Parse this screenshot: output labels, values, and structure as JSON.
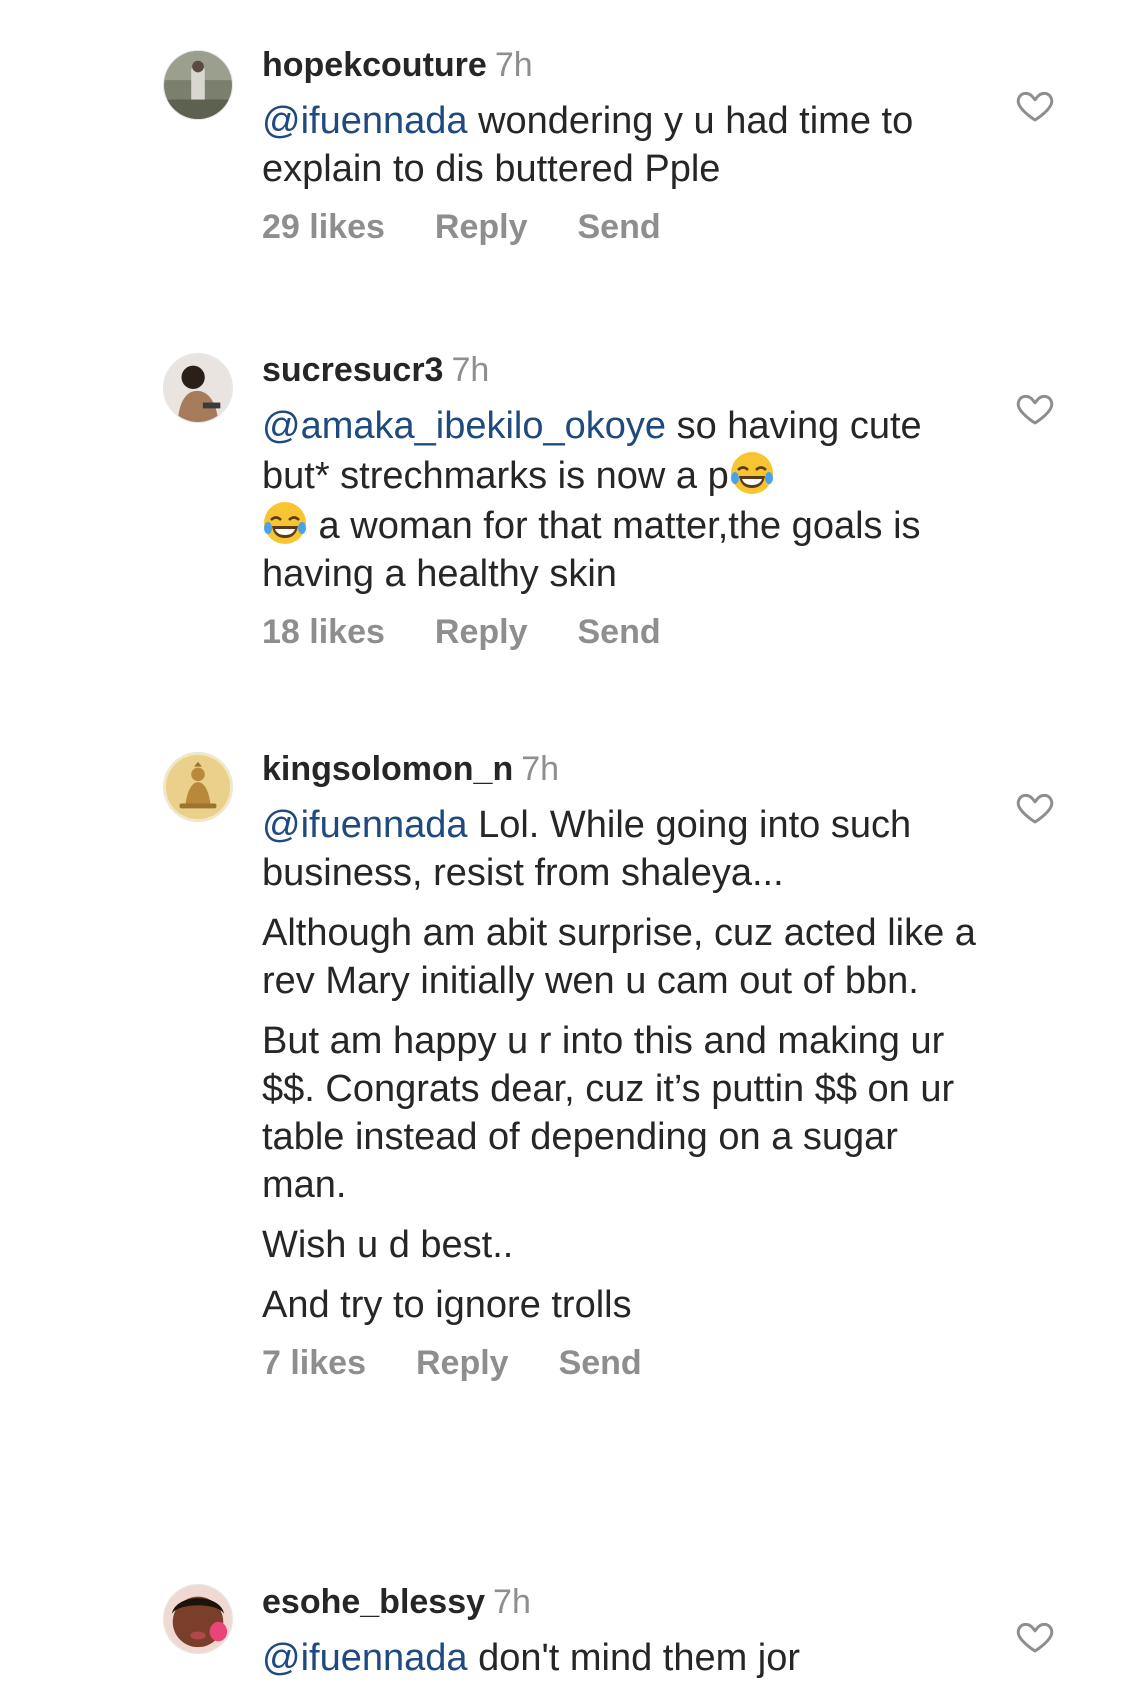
{
  "comments": [
    {
      "username": "hopekcouture",
      "time": "7h",
      "mention": "@ifuennada",
      "text_after_mention": " wondering y u had time to explain to dis buttered Pple",
      "likes": "29 likes",
      "reply": "Reply",
      "send": "Send"
    },
    {
      "username": "sucresucr3",
      "time": "7h",
      "mention": "@amaka_ibekilo_okoye",
      "text_part1": " so having cute but* strechmarks is now a p",
      "text_part2": " a woman for that matter,the goals is having a healthy skin",
      "emoji": "face-with-tears-of-joy",
      "likes": "18 likes",
      "reply": "Reply",
      "send": "Send"
    },
    {
      "username": "kingsolomon_n",
      "time": "7h",
      "mention": "@ifuennada",
      "text_after_mention": " Lol. While going into such business, resist from shaleya...",
      "paragraphs": [
        "Although am abit surprise, cuz acted like a rev Mary initially wen u cam out of bbn.",
        "But am happy u r into this and making ur $$. Congrats dear, cuz it’s puttin $$ on ur table instead of depending on a sugar man.",
        "Wish u d best..",
        "And try to ignore trolls"
      ],
      "likes": "7 likes",
      "reply": "Reply",
      "send": "Send"
    },
    {
      "username": "esohe_blessy",
      "time": "7h",
      "mention": "@ifuennada",
      "text_after_mention": " don't mind them jor"
    }
  ],
  "icons": {
    "like": "heart-outline-icon"
  },
  "colors": {
    "mention": "#1f4a7f",
    "secondary_text": "#8e8e8e",
    "primary_text": "#262626"
  }
}
